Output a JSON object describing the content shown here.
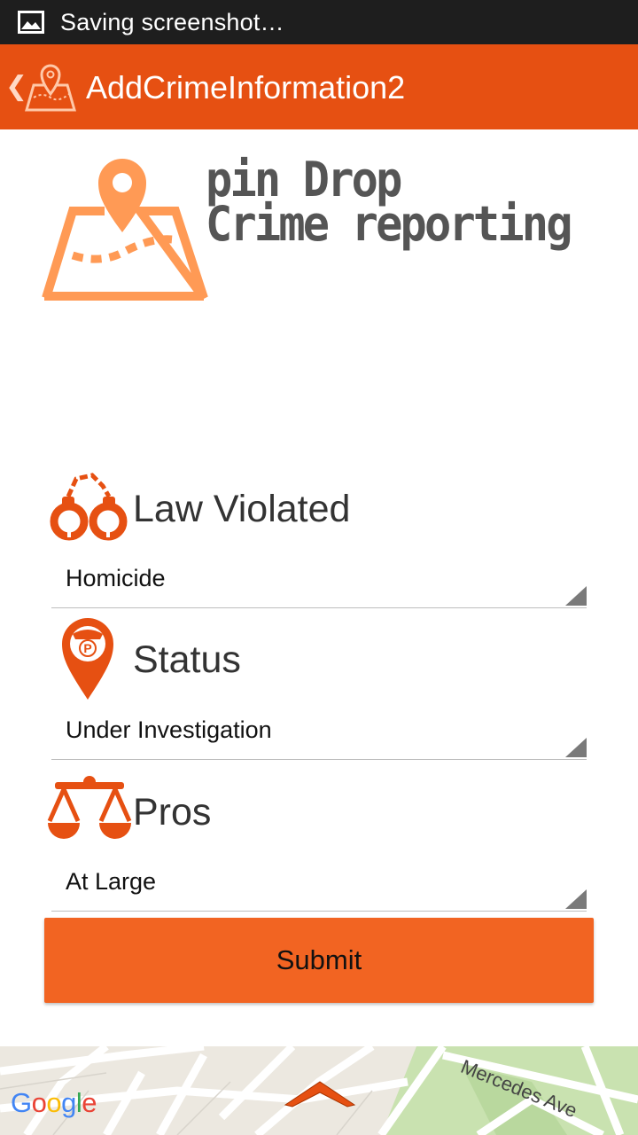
{
  "status_bar": {
    "text": "Saving screenshot…"
  },
  "action_bar": {
    "title": "AddCrimeInformation2"
  },
  "logo": {
    "line1": "pin Drop",
    "line2": "Crime reporting"
  },
  "form": {
    "law": {
      "label": "Law Violated",
      "value": "Homicide"
    },
    "status": {
      "label": "Status",
      "value": "Under Investigation"
    },
    "pros": {
      "label": "Pros",
      "value": "At Large"
    },
    "submit_label": "Submit"
  },
  "map": {
    "street_label": "Mercedes Ave",
    "google": [
      "G",
      "o",
      "o",
      "g",
      "l",
      "e"
    ]
  },
  "colors": {
    "accent": "#e65012",
    "button": "#f26422",
    "icon": "#e65012",
    "logo_orange": "#ff9a55"
  },
  "icons": {
    "status_bar": "image-icon",
    "action_bar": "map-pin-icon",
    "law": "handcuffs-icon",
    "status": "police-pin-icon",
    "pros": "scales-icon",
    "map": "chevron-up-icon"
  }
}
